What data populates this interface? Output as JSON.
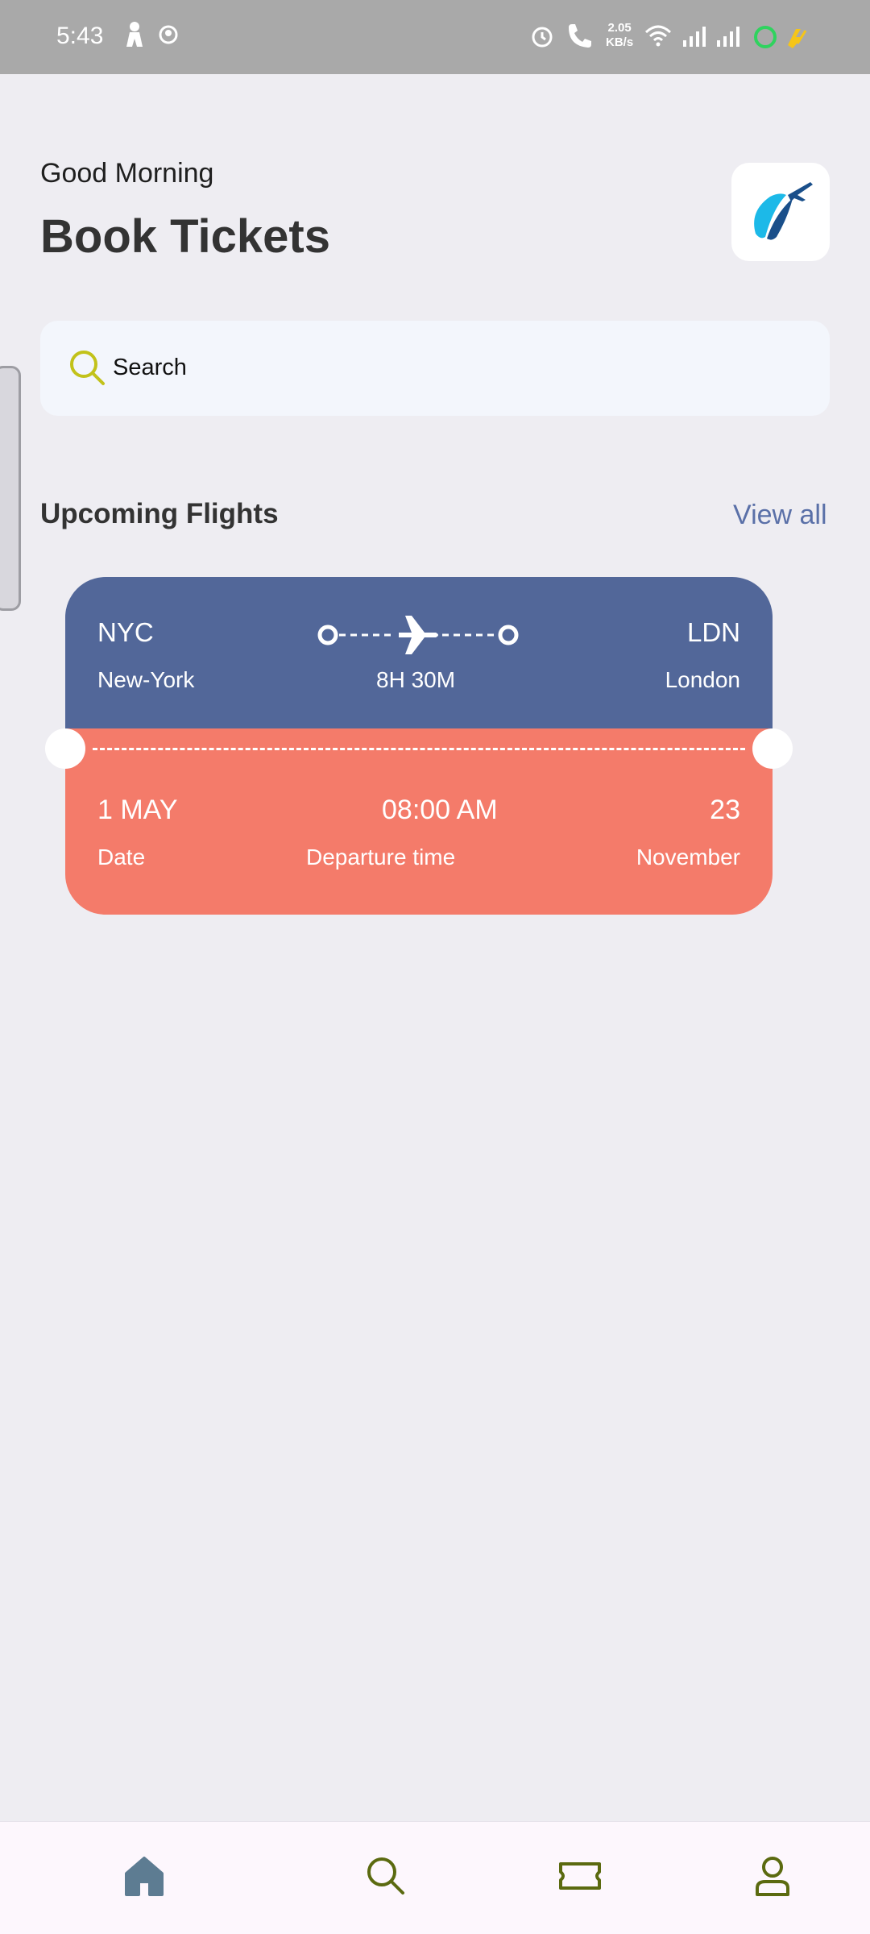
{
  "status_bar": {
    "time": "5:43",
    "speed_value": "2.05",
    "speed_unit": "KB/s",
    "icons": [
      "person-icon",
      "circle-app-icon",
      "alarm-icon",
      "call-icon",
      "wifi-icon",
      "signal-icon",
      "signal-icon",
      "battery-icon"
    ]
  },
  "header": {
    "greeting": "Good Morning",
    "title": "Book Tickets",
    "logo_icon": "airline-logo-icon"
  },
  "search": {
    "label": "Search",
    "icon": "search-icon",
    "icon_color": "#c2c21a"
  },
  "upcoming": {
    "title": "Upcoming Flights",
    "view_all": "View all"
  },
  "ticket": {
    "from_code": "NYC",
    "from_city": "New-York",
    "to_code": "LDN",
    "to_city": "London",
    "duration": "8H 30M",
    "date_value": "1 MAY",
    "date_label": "Date",
    "time_value": "08:00 AM",
    "time_label": "Departure time",
    "extra_value": "23",
    "extra_label": "November",
    "colors": {
      "top": "#526799",
      "bottom": "#f47b6a"
    }
  },
  "bottom_nav": {
    "items": [
      {
        "icon": "home-icon",
        "active": true
      },
      {
        "icon": "search-icon",
        "active": false
      },
      {
        "icon": "ticket-icon",
        "active": false
      },
      {
        "icon": "profile-icon",
        "active": false
      }
    ],
    "active_color": "#5d7c92",
    "inactive_color": "#5b6a10"
  }
}
